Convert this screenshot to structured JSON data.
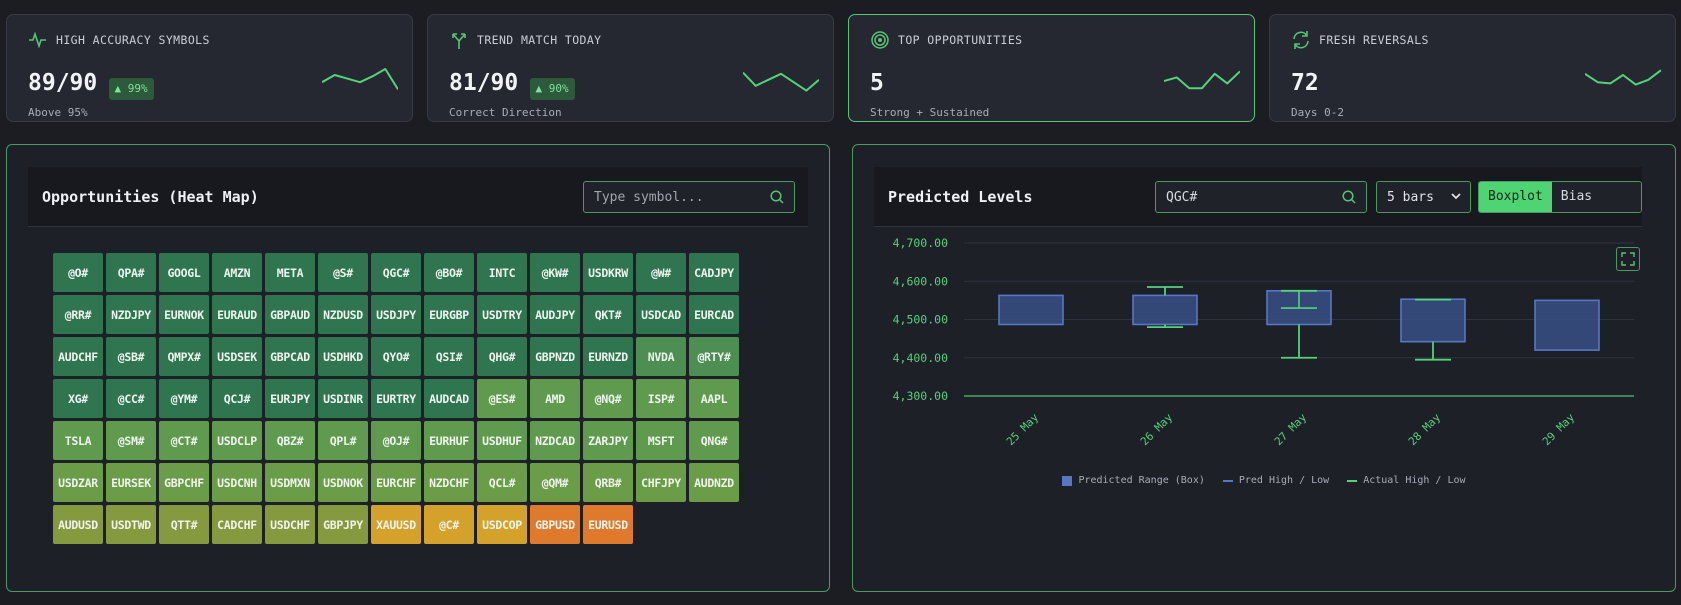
{
  "kpis": [
    {
      "title": "HIGH ACCURACY SYMBOLS",
      "value": "89/90",
      "badge": "▲ 99%",
      "sub": "Above 95%",
      "icon": "activity-icon",
      "spark": [
        0.55,
        0.25,
        0.4,
        0.55,
        0.3,
        0.0,
        0.85
      ]
    },
    {
      "title": "TREND MATCH TODAY",
      "value": "81/90",
      "badge": "▲ 90%",
      "sub": "Correct Direction",
      "icon": "split-arrows-icon",
      "spark": [
        0.15,
        0.7,
        0.45,
        0.2,
        0.55,
        0.9,
        0.45
      ]
    },
    {
      "title": "TOP OPPORTUNITIES",
      "value": "5",
      "badge": "",
      "sub": "Strong + Sustained",
      "icon": "target-icon",
      "spark": [
        0.5,
        0.35,
        0.8,
        0.8,
        0.2,
        0.6,
        0.1
      ]
    },
    {
      "title": "FRESH REVERSALS",
      "value": "72",
      "badge": "",
      "sub": "Days 0-2",
      "icon": "refresh-icon",
      "spark": [
        0.2,
        0.55,
        0.6,
        0.25,
        0.65,
        0.45,
        0.05
      ]
    }
  ],
  "heatmap": {
    "title": "Opportunities (Heat Map)",
    "search_placeholder": "Type symbol...",
    "cells": [
      {
        "s": "@O#",
        "c": "#2e7550"
      },
      {
        "s": "QPA#",
        "c": "#2e7550"
      },
      {
        "s": "GOOGL",
        "c": "#2e7550"
      },
      {
        "s": "AMZN",
        "c": "#2e7550"
      },
      {
        "s": "META",
        "c": "#2e7550"
      },
      {
        "s": "@S#",
        "c": "#2e7550"
      },
      {
        "s": "QGC#",
        "c": "#2e7550"
      },
      {
        "s": "@BO#",
        "c": "#2e7550"
      },
      {
        "s": "INTC",
        "c": "#2e7550"
      },
      {
        "s": "@KW#",
        "c": "#2e7550"
      },
      {
        "s": "USDKRW",
        "c": "#2e7550"
      },
      {
        "s": "@W#",
        "c": "#2e7550"
      },
      {
        "s": "CADJPY",
        "c": "#2e7550"
      },
      {
        "s": "@RR#",
        "c": "#2e7550"
      },
      {
        "s": "NZDJPY",
        "c": "#2e7550"
      },
      {
        "s": "EURNOK",
        "c": "#2e7550"
      },
      {
        "s": "EURAUD",
        "c": "#2e7550"
      },
      {
        "s": "GBPAUD",
        "c": "#2e7550"
      },
      {
        "s": "NZDUSD",
        "c": "#2e7550"
      },
      {
        "s": "USDJPY",
        "c": "#2e7550"
      },
      {
        "s": "EURGBP",
        "c": "#2e7550"
      },
      {
        "s": "USDTRY",
        "c": "#2e7550"
      },
      {
        "s": "AUDJPY",
        "c": "#2e7550"
      },
      {
        "s": "QKT#",
        "c": "#2e7550"
      },
      {
        "s": "USDCAD",
        "c": "#2e7550"
      },
      {
        "s": "EURCAD",
        "c": "#2e7550"
      },
      {
        "s": "AUDCHF",
        "c": "#2e7550"
      },
      {
        "s": "@SB#",
        "c": "#2e7550"
      },
      {
        "s": "QMPX#",
        "c": "#2e7550"
      },
      {
        "s": "USDSEK",
        "c": "#2e7550"
      },
      {
        "s": "GBPCAD",
        "c": "#2e7550"
      },
      {
        "s": "USDHKD",
        "c": "#2e7550"
      },
      {
        "s": "QYO#",
        "c": "#2e7550"
      },
      {
        "s": "QSI#",
        "c": "#2e7550"
      },
      {
        "s": "QHG#",
        "c": "#2e7550"
      },
      {
        "s": "GBPNZD",
        "c": "#2e7550"
      },
      {
        "s": "EURNZD",
        "c": "#2e7550"
      },
      {
        "s": "NVDA",
        "c": "#4d8f52"
      },
      {
        "s": "@RTY#",
        "c": "#4d8f52"
      },
      {
        "s": "XG#",
        "c": "#2e7550"
      },
      {
        "s": "@CC#",
        "c": "#2e7550"
      },
      {
        "s": "@YM#",
        "c": "#2e7550"
      },
      {
        "s": "QCJ#",
        "c": "#2e7550"
      },
      {
        "s": "EURJPY",
        "c": "#2e7550"
      },
      {
        "s": "USDINR",
        "c": "#2e7550"
      },
      {
        "s": "EURTRY",
        "c": "#2e7550"
      },
      {
        "s": "AUDCAD",
        "c": "#2e7550"
      },
      {
        "s": "@ES#",
        "c": "#5f9a4e"
      },
      {
        "s": "AMD",
        "c": "#5f9a4e"
      },
      {
        "s": "@NQ#",
        "c": "#5f9a4e"
      },
      {
        "s": "ISP#",
        "c": "#5f9a4e"
      },
      {
        "s": "AAPL",
        "c": "#5f9a4e"
      },
      {
        "s": "TSLA",
        "c": "#5f9a4e"
      },
      {
        "s": "@SM#",
        "c": "#5f9a4e"
      },
      {
        "s": "@CT#",
        "c": "#5f9a4e"
      },
      {
        "s": "USDCLP",
        "c": "#5f9a4e"
      },
      {
        "s": "QBZ#",
        "c": "#5f9a4e"
      },
      {
        "s": "QPL#",
        "c": "#5f9a4e"
      },
      {
        "s": "@OJ#",
        "c": "#5f9a4e"
      },
      {
        "s": "EURHUF",
        "c": "#5f9a4e"
      },
      {
        "s": "USDHUF",
        "c": "#5f9a4e"
      },
      {
        "s": "NZDCAD",
        "c": "#5f9a4e"
      },
      {
        "s": "ZARJPY",
        "c": "#5f9a4e"
      },
      {
        "s": "MSFT",
        "c": "#5f9a4e"
      },
      {
        "s": "QNG#",
        "c": "#5f9a4e"
      },
      {
        "s": "USDZAR",
        "c": "#6b9c48"
      },
      {
        "s": "EURSEK",
        "c": "#6b9c48"
      },
      {
        "s": "GBPCHF",
        "c": "#6b9c48"
      },
      {
        "s": "USDCNH",
        "c": "#6b9c48"
      },
      {
        "s": "USDMXN",
        "c": "#6b9c48"
      },
      {
        "s": "USDNOK",
        "c": "#6b9c48"
      },
      {
        "s": "EURCHF",
        "c": "#6b9c48"
      },
      {
        "s": "NZDCHF",
        "c": "#6b9c48"
      },
      {
        "s": "QCL#",
        "c": "#6b9c48"
      },
      {
        "s": "@QM#",
        "c": "#6b9c48"
      },
      {
        "s": "QRB#",
        "c": "#6b9c48"
      },
      {
        "s": "CHFJPY",
        "c": "#6b9c48"
      },
      {
        "s": "AUDNZD",
        "c": "#6b9c48"
      },
      {
        "s": "AUDUSD",
        "c": "#859a3e"
      },
      {
        "s": "USDTWD",
        "c": "#859a3e"
      },
      {
        "s": "QTT#",
        "c": "#859a3e"
      },
      {
        "s": "CADCHF",
        "c": "#859a3e"
      },
      {
        "s": "USDCHF",
        "c": "#859a3e"
      },
      {
        "s": "GBPJPY",
        "c": "#859a3e"
      },
      {
        "s": "XAUUSD",
        "c": "#d4a22a"
      },
      {
        "s": "@C#",
        "c": "#d4a22a"
      },
      {
        "s": "USDCOP",
        "c": "#d4a22a"
      },
      {
        "s": "GBPUSD",
        "c": "#df7a2c"
      },
      {
        "s": "EURUSD",
        "c": "#df7a2c"
      }
    ]
  },
  "levels": {
    "title": "Predicted Levels",
    "search_value": "QGC#",
    "bars_select": "5 bars",
    "view_boxplot": "Boxplot",
    "view_bias": "Bias Lines",
    "legend": {
      "box": "Predicted Range (Box)",
      "pred": "Pred High / Low",
      "actual": "Actual High / Low"
    }
  },
  "chart_data": {
    "type": "boxplot",
    "categories": [
      "25 May",
      "26 May",
      "27 May",
      "28 May",
      "29 May"
    ],
    "ylim": [
      4300,
      4700
    ],
    "yticks": [
      "4,700.00",
      "4,600.00",
      "4,500.00",
      "4,400.00",
      "4,300.00"
    ],
    "yvals": [
      4700,
      4600,
      4500,
      4400,
      4300
    ],
    "box_low": [
      4487,
      4487,
      4487,
      4442,
      4420
    ],
    "box_high": [
      4563,
      4563,
      4575,
      4553,
      4550
    ],
    "actual_high": [
      null,
      4585,
      4575,
      4552,
      null
    ],
    "actual_low": [
      null,
      4480,
      4400,
      4395,
      null
    ],
    "actual_mid": [
      null,
      null,
      4530,
      null,
      null
    ],
    "colors": {
      "box": "#3b5593",
      "pred": "#5677c2",
      "actual": "#55d27a"
    }
  }
}
